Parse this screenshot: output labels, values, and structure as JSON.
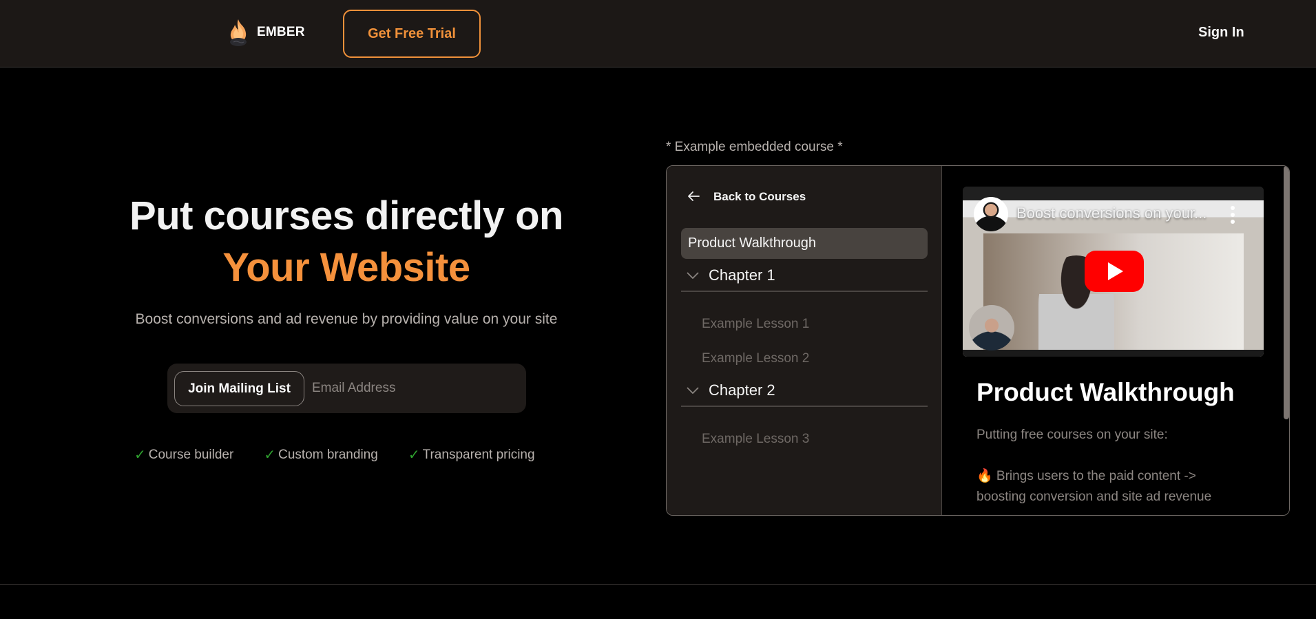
{
  "header": {
    "brand_name": "EMBER",
    "logo_icon": "flame-icon",
    "cta_label": "Get Free Trial",
    "sign_in_label": "Sign In"
  },
  "hero": {
    "title_line1": "Put courses directly on",
    "title_line2": "Your Website",
    "subtitle": "Boost conversions and ad revenue by providing value on your site",
    "mailing": {
      "button_label": "Join Mailing List",
      "email_placeholder": "Email Address",
      "email_value": ""
    },
    "features": [
      {
        "icon": "check-icon",
        "label": "Course builder"
      },
      {
        "icon": "check-icon",
        "label": "Custom branding"
      },
      {
        "icon": "check-icon",
        "label": "Transparent pricing"
      }
    ]
  },
  "example": {
    "label": "* Example embedded course *",
    "sidebar": {
      "back_label": "Back to Courses",
      "active_item": "Product Walkthrough",
      "chapters": [
        {
          "title": "Chapter 1",
          "lessons": [
            "Example Lesson 1",
            "Example Lesson 2"
          ]
        },
        {
          "title": "Chapter 2",
          "lessons": [
            "Example Lesson 3"
          ]
        }
      ]
    },
    "content": {
      "video_title": "Boost conversions on your...",
      "lesson_title": "Product Walkthrough",
      "description": [
        "Putting free courses on your site:",
        "🔥 Brings users to the paid content -> boosting conversion and site ad revenue"
      ]
    }
  },
  "colors": {
    "accent": "#f5913c",
    "header_bg": "#1c1816",
    "panel_bg": "#1e1a18",
    "check": "#2ea02e",
    "play_red": "#ff0000"
  }
}
